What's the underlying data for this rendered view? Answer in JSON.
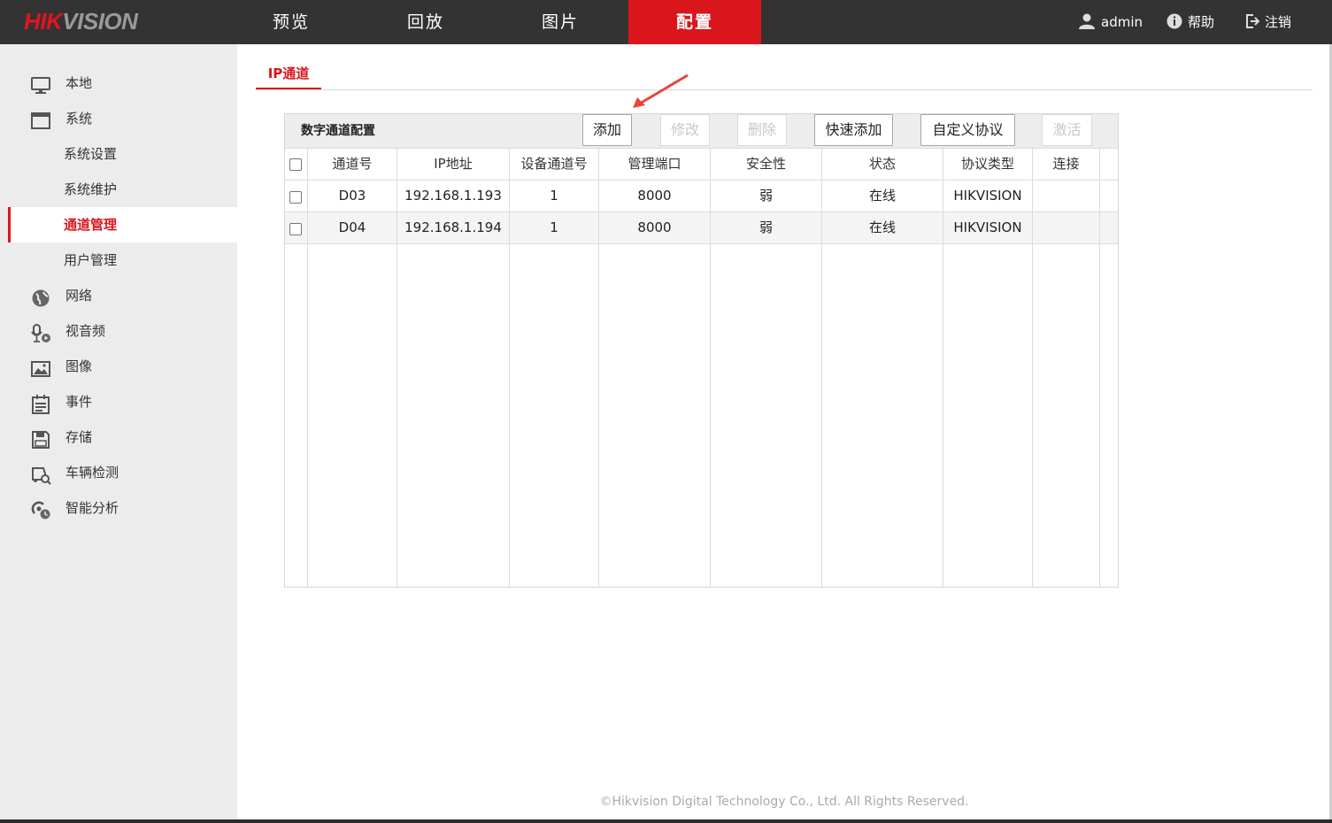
{
  "logo": {
    "part1": "HIK",
    "part2": "VISION"
  },
  "nav": {
    "tabs": [
      {
        "label": "预览"
      },
      {
        "label": "回放"
      },
      {
        "label": "图片"
      },
      {
        "label": "配置"
      }
    ],
    "active": "配置"
  },
  "user_area": {
    "user": "admin",
    "help": "帮助",
    "logout": "注销"
  },
  "sidebar": {
    "local": "本地",
    "system": "系统",
    "system_children": [
      "系统设置",
      "系统维护",
      "通道管理",
      "用户管理"
    ],
    "active_child": "通道管理",
    "network": "网络",
    "video_audio": "视音频",
    "image": "图像",
    "event": "事件",
    "storage": "存储",
    "vehicle": "车辆检测",
    "smart": "智能分析"
  },
  "content": {
    "subtab": "IP通道",
    "panel_title": "数字通道配置",
    "buttons": {
      "add": "添加",
      "modify": "修改",
      "delete": "删除",
      "quick_add": "快速添加",
      "custom_protocol": "自定义协议",
      "activate": "激活"
    },
    "table": {
      "headers": [
        "通道号",
        "IP地址",
        "设备通道号",
        "管理端口",
        "安全性",
        "状态",
        "协议类型",
        "连接"
      ],
      "rows": [
        [
          "D03",
          "192.168.1.193",
          "1",
          "8000",
          "弱",
          "在线",
          "HIKVISION",
          ""
        ],
        [
          "D04",
          "192.168.1.194",
          "1",
          "8000",
          "弱",
          "在线",
          "HIKVISION",
          ""
        ]
      ]
    }
  },
  "footer": "©Hikvision Digital Technology Co., Ltd. All Rights Reserved.",
  "colors": {
    "topbar": "#333333",
    "accent": "#d9161c",
    "sidebar": "#ececec"
  }
}
